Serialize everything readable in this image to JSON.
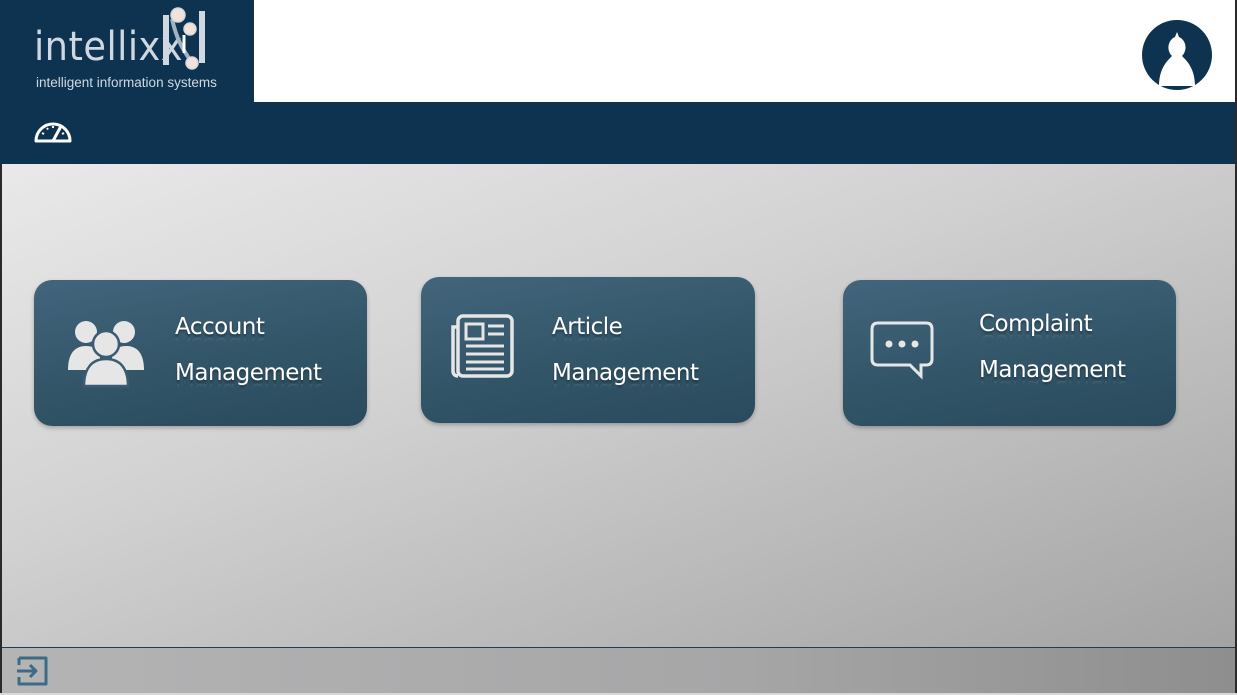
{
  "brand": {
    "name": "intellixx",
    "tagline": "intelligent information systems"
  },
  "header": {
    "avatar_icon": "user-avatar-icon",
    "dashboard_icon": "speedometer-icon"
  },
  "tiles": [
    {
      "line1": "Account",
      "line2": "Management",
      "icon": "users-icon"
    },
    {
      "line1": "Article",
      "line2": "Management",
      "icon": "newspaper-icon"
    },
    {
      "line1": "Complaint",
      "line2": "Management",
      "icon": "chat-bubble-icon"
    }
  ],
  "footer": {
    "logout_icon": "logout-icon"
  },
  "colors": {
    "navy": "#0e3350",
    "tile": "#3a5d73",
    "logo_text": "#cfd8e0"
  }
}
